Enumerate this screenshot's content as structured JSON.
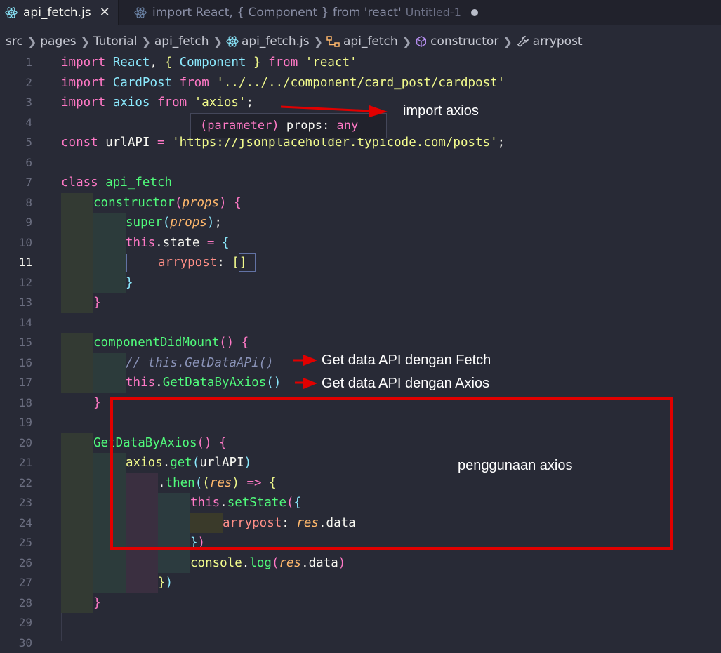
{
  "tabs": [
    {
      "label": "api_fetch.js",
      "active": true,
      "close": "✕"
    },
    {
      "label": "import React, { Component } from 'react'",
      "extra": "Untitled-1",
      "active": false
    }
  ],
  "breadcrumbs": [
    {
      "label": "src",
      "icon": ""
    },
    {
      "label": "pages",
      "icon": ""
    },
    {
      "label": "Tutorial",
      "icon": ""
    },
    {
      "label": "api_fetch",
      "icon": ""
    },
    {
      "label": "api_fetch.js",
      "icon": "react-icon"
    },
    {
      "label": "api_fetch",
      "icon": "class-icon"
    },
    {
      "label": "constructor",
      "icon": "cube-icon"
    },
    {
      "label": "arrypost",
      "icon": "wrench-icon"
    }
  ],
  "line_numbers": [
    "1",
    "2",
    "3",
    "4",
    "5",
    "6",
    "7",
    "8",
    "9",
    "10",
    "11",
    "12",
    "13",
    "14",
    "15",
    "16",
    "17",
    "18",
    "19",
    "20",
    "21",
    "22",
    "23",
    "24",
    "25",
    "26",
    "27",
    "28",
    "29",
    "30"
  ],
  "current_line": "11",
  "code": {
    "l1": {
      "kw": "import",
      "react": "React",
      "p1": ", ",
      "lb": "{",
      "comp": "Component",
      "rb": "}",
      "from": "from",
      "str": "'react'"
    },
    "l2": {
      "kw": "import",
      "name": "CardPost",
      "from": "from",
      "str": "'../../../component/card_post/cardpost'"
    },
    "l3": {
      "kw": "import",
      "name": "axios",
      "from": "from",
      "str": "'axios'",
      "end": ";"
    },
    "l5": {
      "kw": "const",
      "name": "urlAPI",
      "eq": " = ",
      "q1": "'",
      "url": "https://jsonplaceholder.typicode.com/posts",
      "q2": "'",
      "end": ";"
    },
    "l7": {
      "kw": "class",
      "name": "api_fetch"
    },
    "l8": {
      "fn": "constructor",
      "lp": "(",
      "param": "props",
      "rp": ")",
      "lb": "{"
    },
    "l9": {
      "fn": "super",
      "lp": "(",
      "param": "props",
      "rp": ")",
      "end": ";"
    },
    "l10": {
      "kw": "this",
      "dot": ".",
      "prop": "state",
      "eq": " = ",
      "lb": "{"
    },
    "l11": {
      "prop": "arrypost",
      "colon": ": ",
      "val": "[]"
    },
    "l12": {
      "rb": "}"
    },
    "l13": {
      "rb": "}"
    },
    "l15": {
      "fn": "componentDidMount",
      "parens": "()",
      "lb": "{"
    },
    "l16": {
      "comment": "// this.GetDataAPi()"
    },
    "l17": {
      "kw": "this",
      "dot": ".",
      "fn": "GetDataByAxios",
      "parens": "()"
    },
    "l18": {
      "rb": "}"
    },
    "l20": {
      "fn": "GetDataByAxios",
      "parens": "()",
      "lb": "{"
    },
    "l21": {
      "obj": "axios",
      "dot": ".",
      "fn": "get",
      "lp": "(",
      "arg": "urlAPI",
      "rp": ")"
    },
    "l22": {
      "dot": ".",
      "fn": "then",
      "lp": "(",
      "lp2": "(",
      "param": "res",
      "rp2": ")",
      "arrow": " => ",
      "lb": "{"
    },
    "l23": {
      "kw": "this",
      "dot": ".",
      "fn": "setState",
      "lp": "(",
      "lb": "{"
    },
    "l24": {
      "prop": "arrypost",
      "colon": ": ",
      "param": "res",
      "dot": ".",
      "tail": "data"
    },
    "l25": {
      "rb": "}",
      "rp": ")"
    },
    "l26": {
      "obj": "console",
      "dot": ".",
      "fn": "log",
      "lp": "(",
      "param": "res",
      "dot2": ".",
      "tail": "data",
      "rp": ")"
    },
    "l27": {
      "rb": "}",
      "rp": ")"
    },
    "l28": {
      "rb": "}"
    }
  },
  "hover": {
    "p1": "(parameter)",
    "p2": " props: ",
    "p3": "any"
  },
  "annotations": {
    "import_axios": "import axios",
    "fetch": "Get data API dengan Fetch",
    "axios": "Get data API dengan Axios",
    "usage": "penggunaan axios"
  },
  "colors": {
    "highlight_box": "#e10000",
    "arrow": "#e10000",
    "editor_bg": "#282a36"
  }
}
